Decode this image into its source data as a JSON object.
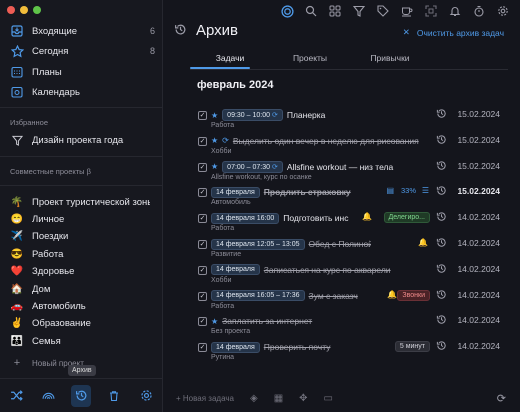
{
  "sidebar": {
    "items": [
      {
        "label": "Входящие",
        "count": "6",
        "icon": "inbox-icon"
      },
      {
        "label": "Сегодня",
        "count": "8",
        "icon": "star-icon"
      },
      {
        "label": "Планы",
        "count": "",
        "icon": "calendar-grid-icon"
      },
      {
        "label": "Календарь",
        "count": "",
        "icon": "calendar-icon"
      }
    ],
    "favorites_header": "Избранное",
    "favorites": [
      {
        "label": "Дизайн проекта года",
        "icon": "filter-icon"
      }
    ],
    "shared_header": "Совместные проекты β",
    "projects": [
      {
        "emoji": "🌴",
        "label": "Проект туристической зоны"
      },
      {
        "emoji": "😁",
        "label": "Личное"
      },
      {
        "emoji": "✈️",
        "label": "Поездки"
      },
      {
        "emoji": "😎",
        "label": "Работа"
      },
      {
        "emoji": "❤️",
        "label": "Здоровье"
      },
      {
        "emoji": "🏠",
        "label": "Дом"
      },
      {
        "emoji": "🚗",
        "label": "Автомобиль"
      },
      {
        "emoji": "✌️",
        "label": "Образование"
      },
      {
        "emoji": "👪",
        "label": "Семья"
      }
    ],
    "new_project": "Новый проект",
    "tooltip": "Архив"
  },
  "header": {
    "title": "Архив",
    "clear_label": "Очистить архив задач"
  },
  "tabs": [
    {
      "label": "Задачи",
      "active": true
    },
    {
      "label": "Проекты",
      "active": false
    },
    {
      "label": "Привычки",
      "active": false
    }
  ],
  "month": "февраль 2024",
  "tasks": [
    {
      "star": true,
      "repeat": false,
      "badge": "09:30 – 10:00",
      "badge_repeat": true,
      "name": "Планерка",
      "done": false,
      "bold": false,
      "sub": "Работа",
      "date": "15.02.2024",
      "date_bold": false
    },
    {
      "star": true,
      "repeat": true,
      "badge": "",
      "name": "Выделить один вечер в неделю для рисования",
      "done": true,
      "bold": false,
      "sub": "Хобби",
      "date": "15.02.2024",
      "date_bold": false
    },
    {
      "star": true,
      "repeat": false,
      "badge": "07:00 – 07:30",
      "badge_repeat": true,
      "name": "Allsfine workout — низ тела",
      "done": false,
      "bold": false,
      "sub": "Allsfine workout, курс по осанке",
      "date": "15.02.2024",
      "date_bold": false
    },
    {
      "star": false,
      "repeat": false,
      "badge": "14 февраля",
      "name": "Продлить страховку",
      "done": true,
      "bold": true,
      "sub": "Автомобиль",
      "date": "15.02.2024",
      "date_bold": true,
      "pct": "33%"
    },
    {
      "star": false,
      "repeat": false,
      "badge": "14 февраля 16:00",
      "name": "Подготовить инс",
      "done": false,
      "bold": false,
      "sub": "Работа",
      "date": "14.02.2024",
      "date_bold": false,
      "bell": true,
      "tag": "Делегиро...",
      "tag_color": "green"
    },
    {
      "star": false,
      "repeat": false,
      "badge": "14 февраля 12:05 – 13:05",
      "name": "Обед с Полиной",
      "done": true,
      "bold": false,
      "sub": "Развитие",
      "date": "14.02.2024",
      "date_bold": false,
      "bell": true
    },
    {
      "star": false,
      "repeat": false,
      "badge": "14 февраля",
      "name": "Записаться на курс по акварели",
      "done": true,
      "bold": false,
      "sub": "Хобби",
      "date": "14.02.2024",
      "date_bold": false
    },
    {
      "star": false,
      "repeat": false,
      "badge": "14 февраля 16:05 – 17:36",
      "name": "Зум с заказч",
      "done": true,
      "bold": false,
      "sub": "Работа",
      "date": "14.02.2024",
      "date_bold": false,
      "bell": true,
      "tag": "Звонки",
      "tag_color": "red"
    },
    {
      "star": true,
      "repeat": false,
      "badge": "",
      "name": "Заплатить за интернет",
      "done": true,
      "bold": false,
      "sub": "Без проекта",
      "date": "14.02.2024",
      "date_bold": false
    },
    {
      "star": false,
      "repeat": false,
      "badge": "14 февраля",
      "name": "Проверить почту",
      "done": true,
      "bold": false,
      "sub": "Рутина",
      "date": "14.02.2024",
      "date_bold": false,
      "tag": "5 минут",
      "tag_color": "gray"
    }
  ],
  "footer": {
    "new_task": "Новая задача"
  },
  "colors": {
    "accent": "#4f9ae8",
    "background": "#14151c",
    "sidebar": "#17181f"
  }
}
